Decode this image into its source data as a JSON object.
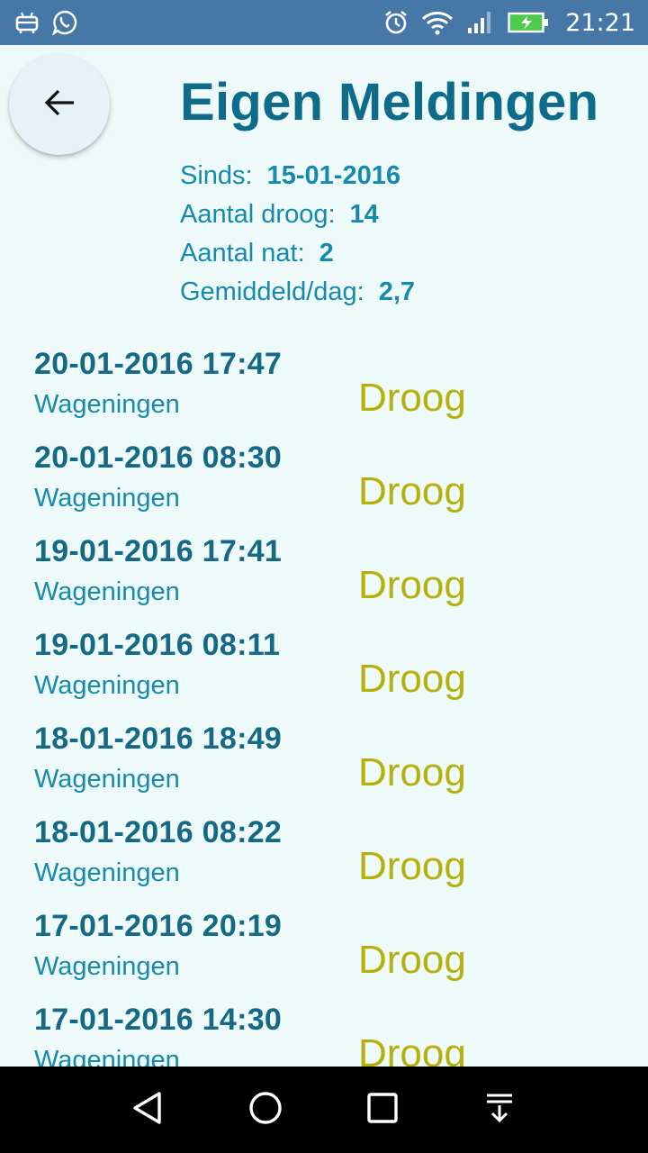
{
  "status_bar": {
    "time": "21:21",
    "left_icons": [
      "android-debug-icon",
      "whatsapp-icon"
    ],
    "right_icons": [
      "alarm-icon",
      "wifi-icon",
      "signal-icon",
      "battery-charging-icon"
    ]
  },
  "header": {
    "title": "Eigen Meldingen"
  },
  "stats": {
    "since_label": "Sinds:",
    "since_value": "15-01-2016",
    "dry_label": "Aantal droog:",
    "dry_value": "14",
    "wet_label": "Aantal nat:",
    "wet_value": "2",
    "avg_label": "Gemiddeld/dag:",
    "avg_value": "2,7"
  },
  "reports": [
    {
      "datetime": "20-01-2016 17:47",
      "place": "Wageningen",
      "status": "Droog"
    },
    {
      "datetime": "20-01-2016 08:30",
      "place": "Wageningen",
      "status": "Droog"
    },
    {
      "datetime": "19-01-2016 17:41",
      "place": "Wageningen",
      "status": "Droog"
    },
    {
      "datetime": "19-01-2016 08:11",
      "place": "Wageningen",
      "status": "Droog"
    },
    {
      "datetime": "18-01-2016 18:49",
      "place": "Wageningen",
      "status": "Droog"
    },
    {
      "datetime": "18-01-2016 08:22",
      "place": "Wageningen",
      "status": "Droog"
    },
    {
      "datetime": "17-01-2016 20:19",
      "place": "Wageningen",
      "status": "Droog"
    },
    {
      "datetime": "17-01-2016 14:30",
      "place": "Wageningen",
      "status": "Droog"
    }
  ],
  "colors": {
    "status_bar": "#4677a6",
    "background": "#eef9fa",
    "title": "#0e6b8a",
    "text_accent": "#158aaa",
    "status_dry": "#b4b10c"
  }
}
